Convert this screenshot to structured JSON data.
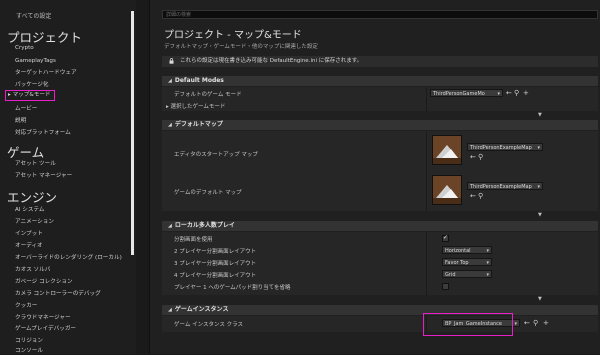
{
  "sidebar": {
    "all_settings": "すべての設定",
    "categories": [
      {
        "title": "プロジェクト",
        "items": [
          "Crypto",
          "GameplayTags",
          "ターゲットハードウェア",
          "パッケージ化",
          "マップ&モード",
          "ムービー",
          "説明",
          "対応プラットフォーム"
        ]
      },
      {
        "title": "ゲーム",
        "items": [
          "アセット ツール",
          "アセット マネージャー"
        ]
      },
      {
        "title": "エンジン",
        "items": [
          "AI システム",
          "アニメーション",
          "インプット",
          "オーディオ",
          "オーバーライドのレンダリング (ローカル)",
          "カオス ソルバ",
          "ガベージ コレクション",
          "カメラ コントローラーのデバッグ",
          "クッカー",
          "クラウドマネージャー",
          "ゲームプレイデバッガー",
          "コリジョン",
          "コンソール"
        ]
      }
    ],
    "active_item": "マップ&モード"
  },
  "main": {
    "search_placeholder": "詳細の検索",
    "title": "プロジェクト - マップ&モード",
    "subtitle": "デフォルトマップ・ゲームモード・他のマップに関連した設定",
    "notice": "これらの設定は現在書き込み可能な DefaultEngine.ini に保存されます。",
    "sections": {
      "default_modes": {
        "title": "Default Modes",
        "default_game_mode_label": "デフォルトのゲーム モード",
        "default_game_mode_value": "ThirdPersonGameMo",
        "selected_game_mode_label": "選択したゲームモード"
      },
      "default_maps": {
        "title": "デフォルトマップ",
        "editor_startup_map_label": "エディタのスタートアップ マップ",
        "editor_startup_map_value": "ThirdPersonExampleMap",
        "game_default_map_label": "ゲームのデフォルト マップ",
        "game_default_map_value": "ThirdPersonExampleMap"
      },
      "local_multiplayer": {
        "title": "ローカル多人数プレイ",
        "use_splitscreen_label": "分割画面を使用",
        "use_splitscreen_checked": true,
        "two_player_label": "2 プレイヤー分割画面レイアウト",
        "two_player_value": "Horizontal",
        "three_player_label": "3 プレイヤー分割画面レイアウト",
        "three_player_value": "Favor Top",
        "four_player_label": "4 プレイヤー分割画面レイアウト",
        "four_player_value": "Grid",
        "skip_gamepad_label": "プレイヤー 1 へのゲームパッド割り当てを省略",
        "skip_gamepad_checked": false
      },
      "game_instance": {
        "title": "ゲームインスタンス",
        "game_instance_class_label": "ゲーム インスタンス クラス",
        "game_instance_class_value": "BP_Jam_GameInstance"
      }
    }
  },
  "colors": {
    "highlight": "#e81ec9",
    "background": "#202020",
    "section_header": "#333333"
  },
  "icons": [
    "lock-icon",
    "arrow-left-icon",
    "browse-icon",
    "plus-icon",
    "chevron-down-icon",
    "caret-right-icon"
  ]
}
